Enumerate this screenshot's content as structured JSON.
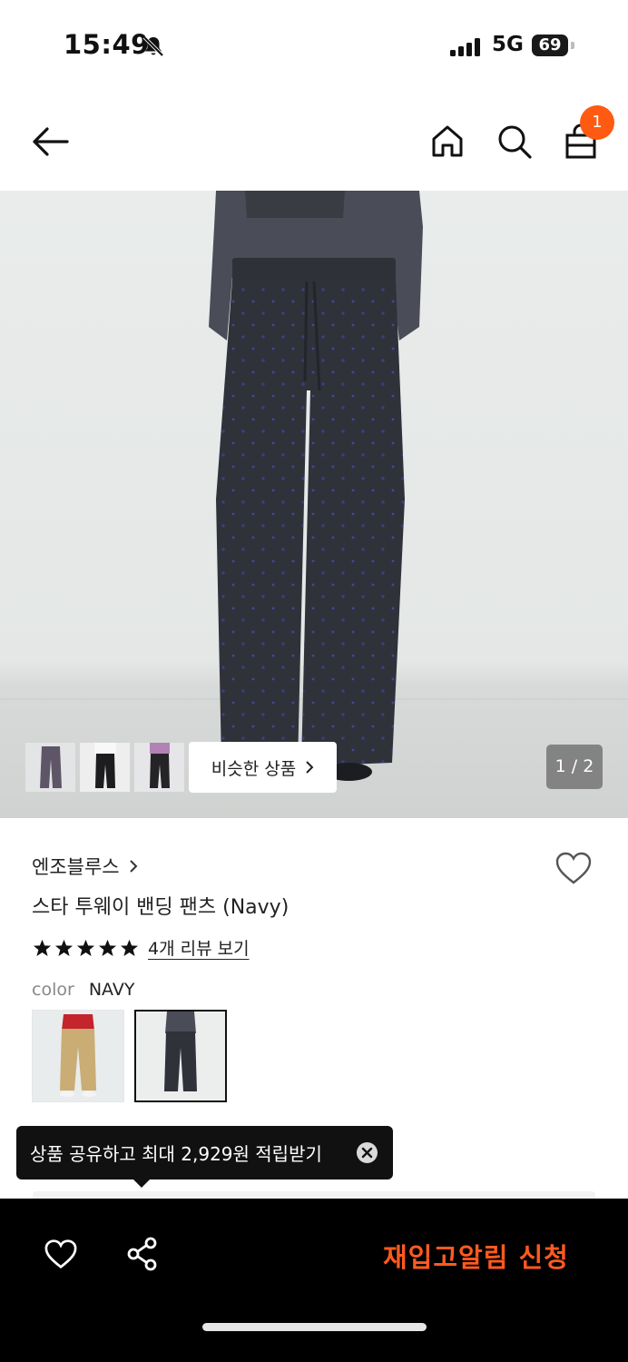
{
  "status_bar": {
    "time": "15:49",
    "network": "5G",
    "battery": "69"
  },
  "nav": {
    "cart_count": "1"
  },
  "gallery": {
    "similar_label": "비슷한 상품",
    "counter": "1 / 2"
  },
  "product": {
    "brand": "엔조블루스",
    "title": "스타 투웨이 밴딩 팬츠 (Navy)",
    "rating_stars": 5,
    "review_link": "4개 리뷰 보기",
    "color_label": "color",
    "color_value": "NAVY"
  },
  "tooltip": {
    "text": "상품 공유하고 최대 2,929원 적립받기"
  },
  "bottom_bar": {
    "restock_label": "재입고알림 신청"
  },
  "colors": {
    "accent": "#ff5a12",
    "restock_text": "#ff5a1f"
  },
  "icons": [
    "bell-slash-icon",
    "signal-icon",
    "back-arrow-icon",
    "home-icon",
    "search-icon",
    "shopping-bag-icon",
    "chevron-right-icon",
    "heart-icon",
    "star-icon",
    "close-icon",
    "share-icon"
  ]
}
